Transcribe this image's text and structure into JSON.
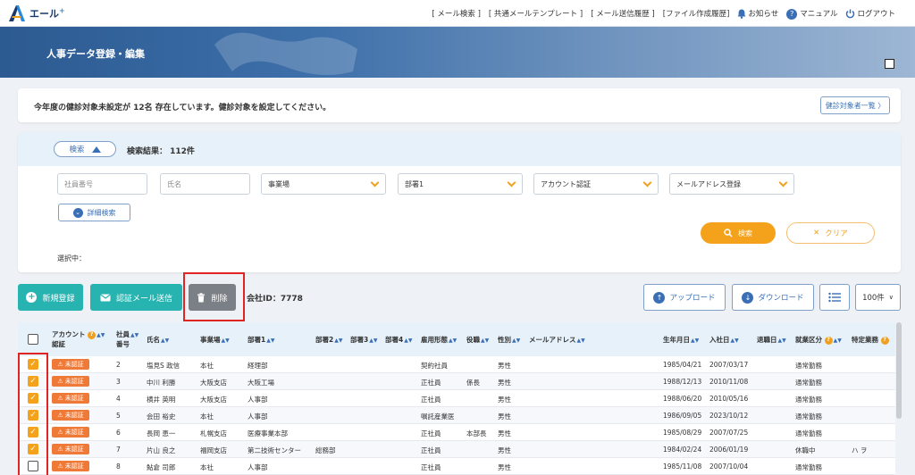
{
  "app": {
    "logo_text": "エール",
    "logo_sup": "+"
  },
  "topnav": {
    "links": [
      "[ メール検索 ]",
      "[ 共通メールテンプレート ]",
      "[ メール送信履歴 ]",
      "[ファイル作成履歴]"
    ],
    "notice": "お知らせ",
    "manual": "マニュアル",
    "logout": "ログアウト"
  },
  "banner": {
    "title": "人事データ登録・編集"
  },
  "notice": {
    "message": "今年度の健診対象未設定が 12名 存在しています。健診対象を設定してください。",
    "button": "健診対象者一覧 〉"
  },
  "search": {
    "toggle": "検索",
    "result": "検索結果： 112件",
    "employee_no_placeholder": "社員番号",
    "name_placeholder": "氏名",
    "office": "事業場",
    "dept1": "部署1",
    "account_auth": "アカウント認証",
    "mail_reg": "メールアドレス登録",
    "advanced": "詳細検索",
    "search_btn": "検索",
    "clear_btn": "クリア",
    "selected": "選択中："
  },
  "actions": {
    "new": "新規登録",
    "send_mail": "認証メール送信",
    "delete": "削除",
    "company_id": "会社ID：7778",
    "upload": "アップロード",
    "download": "ダウンロード",
    "per_page": "100件"
  },
  "table": {
    "headers": {
      "account": "アカウント",
      "account2": "認証",
      "empno": "社員",
      "empno2": "番号",
      "name": "氏名",
      "office": "事業場",
      "dept1": "部署1",
      "dept2": "部署2",
      "dept3": "部署3",
      "dept4": "部署4",
      "emp_type": "雇用形態",
      "position": "役職",
      "gender": "性別",
      "email": "メールアドレス",
      "birth": "生年月日",
      "joined": "入社日",
      "left": "退職日",
      "work_status": "就業区分",
      "special": "特定業務"
    },
    "badge": "未認証",
    "rows": [
      {
        "no": "2",
        "name": "塩見S 政信",
        "office": "本社",
        "dept1": "経理部",
        "dept2": "",
        "type": "契約社員",
        "pos": "",
        "gender": "男性",
        "birth": "1985/04/21",
        "join": "2007/03/17",
        "status": "通常勤務",
        "special": "",
        "checked": true
      },
      {
        "no": "3",
        "name": "中川 利勝",
        "office": "大阪支店",
        "dept1": "大阪工場",
        "dept2": "",
        "type": "正社員",
        "pos": "係長",
        "gender": "男性",
        "birth": "1988/12/13",
        "join": "2010/11/08",
        "status": "通常勤務",
        "special": "",
        "checked": true
      },
      {
        "no": "4",
        "name": "横井 英明",
        "office": "大阪支店",
        "dept1": "人事部",
        "dept2": "",
        "type": "正社員",
        "pos": "",
        "gender": "男性",
        "birth": "1988/06/20",
        "join": "2010/05/16",
        "status": "通常勤務",
        "special": "",
        "checked": true
      },
      {
        "no": "5",
        "name": "会田 裕史",
        "office": "本社",
        "dept1": "人事部",
        "dept2": "",
        "type": "嘱託産業医",
        "pos": "",
        "gender": "男性",
        "birth": "1986/09/05",
        "join": "2023/10/12",
        "status": "通常勤務",
        "special": "",
        "checked": true
      },
      {
        "no": "6",
        "name": "長岡 恵一",
        "office": "札幌支店",
        "dept1": "医療事業本部",
        "dept2": "",
        "type": "正社員",
        "pos": "本部長",
        "gender": "男性",
        "birth": "1985/08/29",
        "join": "2007/07/25",
        "status": "通常勤務",
        "special": "",
        "checked": true
      },
      {
        "no": "7",
        "name": "片山 良之",
        "office": "福岡支店",
        "dept1": "第二技術センター",
        "dept2": "総務部",
        "type": "正社員",
        "pos": "",
        "gender": "男性",
        "birth": "1984/02/24",
        "join": "2006/01/19",
        "status": "休職中",
        "special": "ハ ヲ",
        "checked": true
      },
      {
        "no": "8",
        "name": "鮎倉 司郎",
        "office": "本社",
        "dept1": "人事部",
        "dept2": "",
        "type": "正社員",
        "pos": "",
        "gender": "男性",
        "birth": "1985/11/08",
        "join": "2007/10/04",
        "status": "通常勤務",
        "special": "",
        "checked": false
      }
    ]
  }
}
